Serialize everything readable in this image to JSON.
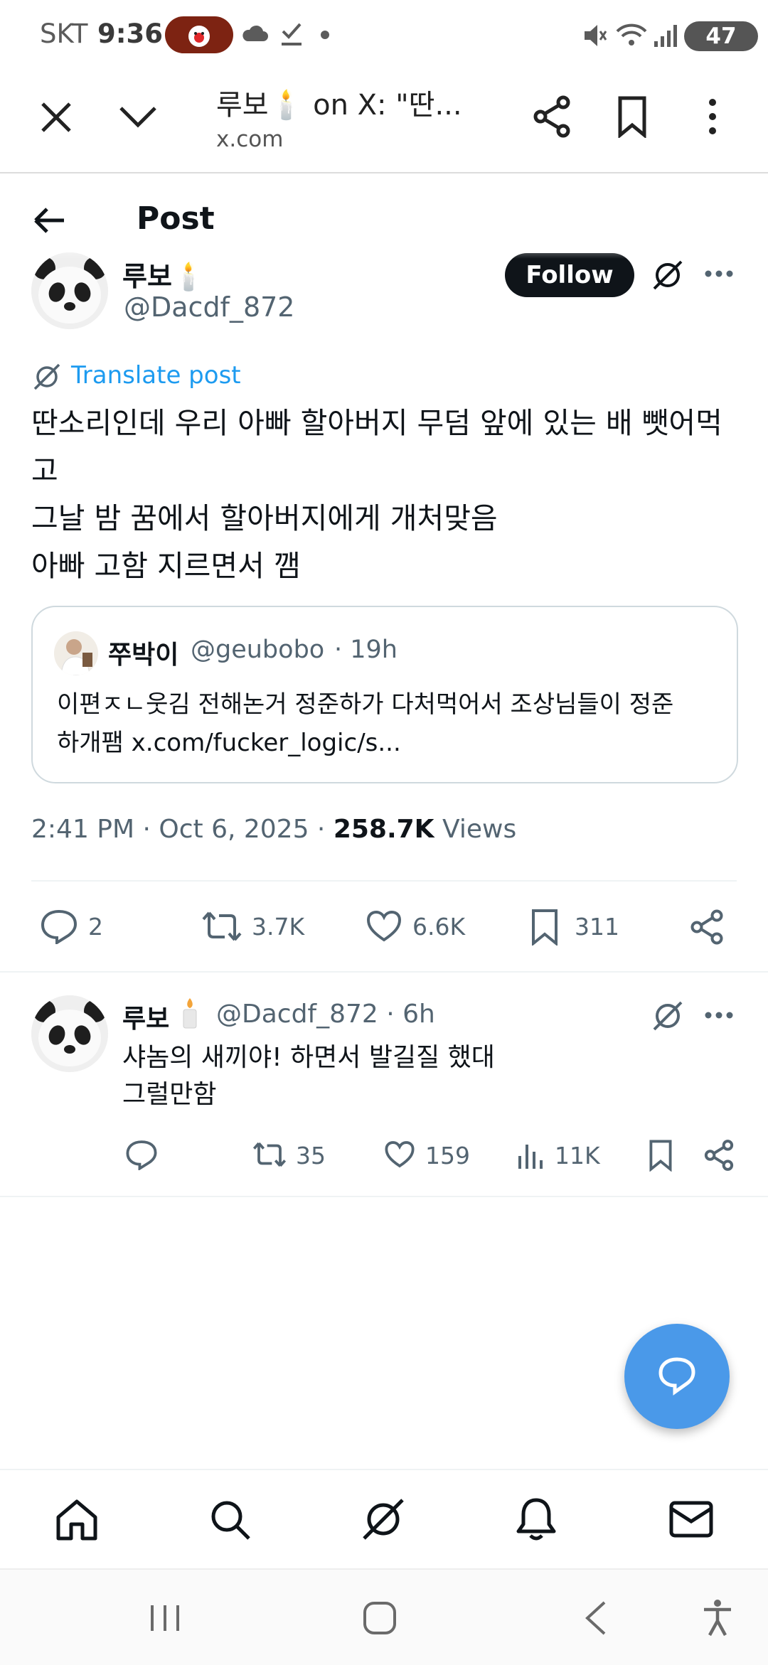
{
  "status_bar": {
    "carrier": "SKT",
    "time": "9:36",
    "battery": "47"
  },
  "browser": {
    "tab_title": "루보🕯️ on X: \"딴...",
    "url": "x.com"
  },
  "header": {
    "title": "Post"
  },
  "post": {
    "author_name": "루보🕯️",
    "handle": "@Dacdf_872",
    "follow_label": "Follow",
    "translate_label": "Translate post",
    "text": "딴소리인데 우리 아빠 할아버지 무덤 앞에 있는 배 뺏어먹\n고\n그날 밤 꿈에서 할아버지에게 개처맞음\n아빠 고함 지르면서 깸",
    "quote": {
      "name": "쭈박이",
      "handle": "@geubobo",
      "time": "· 19h",
      "text": "이편ㅈㄴ웃김 전해논거 정준하가 다처먹어서 조상님들이 정준\n하개팸 x.com/fucker_logic/s..."
    },
    "timestamp": "2:41 PM · Oct 6, 2025 · ",
    "views_count": "258.7K",
    "views_label": " Views",
    "actions": {
      "replies": "2",
      "reposts": "3.7K",
      "likes": "6.6K",
      "bookmarks": "311"
    }
  },
  "reply": {
    "name": "루보",
    "handle": "@Dacdf_872 · 6h",
    "text": "샤놈의 새끼야! 하면서 발길질 했대\n그럴만함",
    "actions": {
      "reposts": "35",
      "likes": "159",
      "views": "11K"
    }
  },
  "colors": {
    "accent": "#1d9bf0",
    "fab": "#4a99e9",
    "text_primary": "#0f1419",
    "text_secondary": "#536471",
    "status_pill": "#7d2312"
  },
  "icons": {
    "close": "close-icon",
    "collapse": "chevron-down-icon",
    "share": "share-icon",
    "bookmark": "bookmark-icon",
    "more": "more-vertical-icon",
    "back": "arrow-left-icon",
    "grok": "grok-icon",
    "reply": "reply-icon",
    "repost": "repost-icon",
    "like": "heart-icon",
    "views": "views-icon",
    "home": "home-icon",
    "search": "search-icon",
    "notifications": "bell-icon",
    "messages": "mail-icon"
  }
}
